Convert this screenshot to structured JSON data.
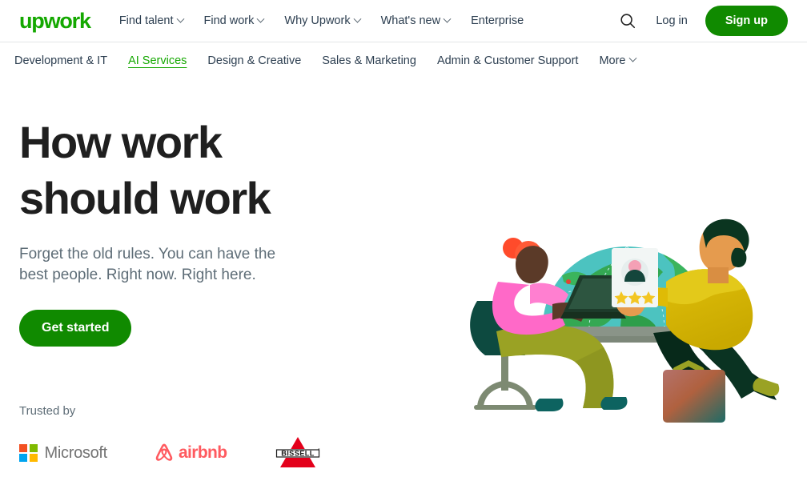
{
  "brand": {
    "logo_text": "upwork",
    "logo_color": "#14a800",
    "accent_green": "#108a00"
  },
  "header": {
    "nav": [
      {
        "label": "Find talent",
        "has_dropdown": true
      },
      {
        "label": "Find work",
        "has_dropdown": true
      },
      {
        "label": "Why Upwork",
        "has_dropdown": true
      },
      {
        "label": "What's new",
        "has_dropdown": true
      },
      {
        "label": "Enterprise",
        "has_dropdown": false
      }
    ],
    "search_icon": "search-icon",
    "login_label": "Log in",
    "signup_label": "Sign up"
  },
  "category_nav": {
    "items": [
      {
        "label": "Development & IT",
        "active": false,
        "has_dropdown": false
      },
      {
        "label": "AI Services",
        "active": true,
        "has_dropdown": false
      },
      {
        "label": "Design & Creative",
        "active": false,
        "has_dropdown": false
      },
      {
        "label": "Sales & Marketing",
        "active": false,
        "has_dropdown": false
      },
      {
        "label": "Admin & Customer Support",
        "active": false,
        "has_dropdown": false
      },
      {
        "label": "More",
        "active": false,
        "has_dropdown": true
      }
    ],
    "active_color": "#14a800"
  },
  "hero": {
    "headline_line1": "How work",
    "headline_line2": "should work",
    "subheadline": "Forget the old rules. You can have the best people. Right now. Right here.",
    "cta_label": "Get started",
    "illustration": {
      "name": "people-collaborating-globe-illustration",
      "globe_ocean_color": "#4cc3c0",
      "globe_land_color": "#34a853",
      "woman_sweater_color": "#ff69c8",
      "woman_hair_color": "#ff5a36",
      "woman_pants_color": "#9aa224",
      "man_sweater_color": "#d9b800",
      "man_pants_color": "#07291a",
      "chair_color": "#0d4a40",
      "briefcase_color": "#a8664f",
      "card_stars": 3
    }
  },
  "trusted_by": {
    "label": "Trusted by",
    "brands": [
      {
        "name": "Microsoft",
        "wordmark": "Microsoft",
        "colors": [
          "#f25022",
          "#7fba00",
          "#00a4ef",
          "#ffb900"
        ]
      },
      {
        "name": "Airbnb",
        "wordmark": "airbnb",
        "color": "#FF5A5F"
      },
      {
        "name": "Bissell",
        "wordmark": "BISSELL",
        "color": "#e3001b"
      }
    ]
  }
}
